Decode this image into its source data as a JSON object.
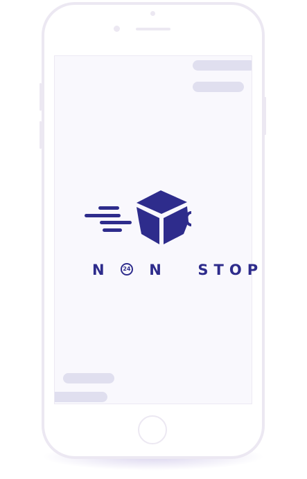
{
  "brand": {
    "word_left_initial": "N",
    "badge_text": "24",
    "word_left_rest": "N",
    "word_right": "STOP",
    "color": "#2e2c8c"
  },
  "icons": {
    "logo": "delivery-box-icon",
    "speed_lines": "motion-lines-icon"
  },
  "colors": {
    "phone_frame": "#ece8f2",
    "screen_bg": "#f9f8fd",
    "placeholder": "#e0dfef"
  }
}
